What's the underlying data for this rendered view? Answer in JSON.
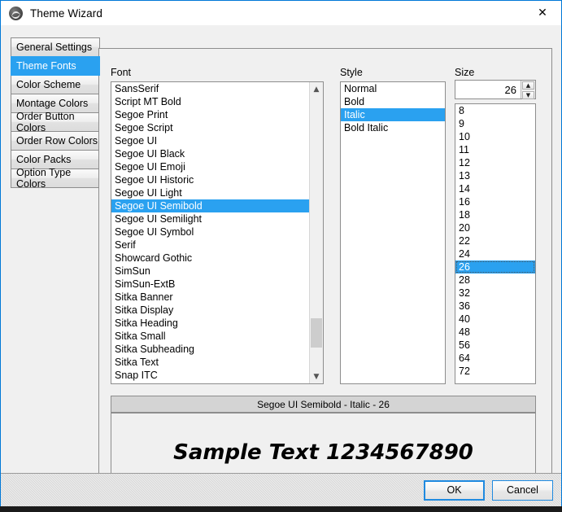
{
  "window": {
    "title": "Theme Wizard",
    "icon": "theme-wizard-icon",
    "close_label": "✕"
  },
  "sidebar": {
    "items": [
      {
        "label": "General Settings",
        "selected": false
      },
      {
        "label": "Theme Fonts",
        "selected": true
      },
      {
        "label": "Color Scheme",
        "selected": false
      },
      {
        "label": "Montage Colors",
        "selected": false
      },
      {
        "label": "Order Button Colors",
        "selected": false
      },
      {
        "label": "Order Row Colors",
        "selected": false
      },
      {
        "label": "Color Packs",
        "selected": false
      },
      {
        "label": "Option Type Colors",
        "selected": false
      }
    ]
  },
  "font_column": {
    "label": "Font",
    "selected": "Segoe UI Semibold",
    "items": [
      "SansSerif",
      "Script MT Bold",
      "Segoe Print",
      "Segoe Script",
      "Segoe UI",
      "Segoe UI Black",
      "Segoe UI Emoji",
      "Segoe UI Historic",
      "Segoe UI Light",
      "Segoe UI Semibold",
      "Segoe UI Semilight",
      "Segoe UI Symbol",
      "Serif",
      "Showcard Gothic",
      "SimSun",
      "SimSun-ExtB",
      "Sitka Banner",
      "Sitka Display",
      "Sitka Heading",
      "Sitka Small",
      "Sitka Subheading",
      "Sitka Text",
      "Snap ITC"
    ],
    "scroll_up_icon": "chevron-up-icon",
    "scroll_down_icon": "chevron-down-icon"
  },
  "style_column": {
    "label": "Style",
    "selected": "Italic",
    "items": [
      "Normal",
      "Bold",
      "Italic",
      "Bold Italic"
    ]
  },
  "size_column": {
    "label": "Size",
    "value": "26",
    "selected": "26",
    "spin_up_icon": "spinner-up-icon",
    "spin_down_icon": "spinner-down-icon",
    "items": [
      "8",
      "9",
      "10",
      "11",
      "12",
      "13",
      "14",
      "16",
      "18",
      "20",
      "22",
      "24",
      "26",
      "28",
      "32",
      "36",
      "40",
      "48",
      "56",
      "64",
      "72"
    ]
  },
  "preview": {
    "header": "Segoe UI Semibold - Italic - 26",
    "sample_text": "Sample Text 1234567890"
  },
  "footer": {
    "ok_label": "OK",
    "cancel_label": "Cancel"
  },
  "colors": {
    "accent": "#2aa1f0",
    "button_border": "#1f8ae0",
    "window_bg": "#f0f0f0"
  }
}
